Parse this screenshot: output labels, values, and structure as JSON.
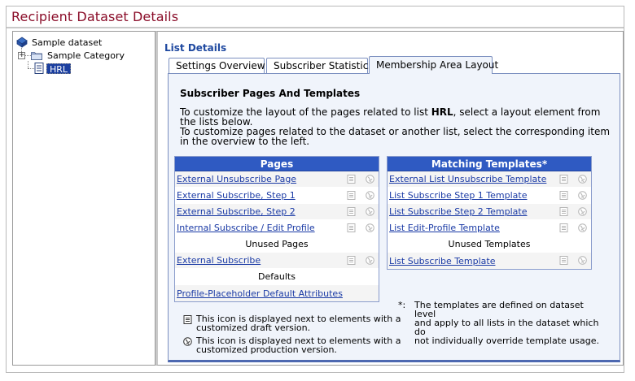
{
  "title": "Recipient Dataset Details",
  "tree": {
    "root": "Sample dataset",
    "category": "Sample Category",
    "selected": "HRL"
  },
  "list_details_title": "List Details",
  "tabs": [
    {
      "label": "Settings Overview"
    },
    {
      "label": "Subscriber Statistics"
    },
    {
      "label": "Membership Area Layout"
    }
  ],
  "section": {
    "title": "Subscriber Pages And Templates",
    "para1_pre": "To customize the layout of the pages related to list ",
    "para1_list": "HRL",
    "para1_post": ", select a layout element from the lists below.",
    "para2": "To customize pages related to the dataset or another list, select the corresponding item in the overview to the left."
  },
  "pages_table": {
    "header": "Pages",
    "rows": [
      {
        "label": "External Unsubscribe Page"
      },
      {
        "label": "External Subscribe, Step 1"
      },
      {
        "label": "External Subscribe, Step 2"
      },
      {
        "label": "Internal Subscribe / Edit Profile"
      }
    ],
    "unused_header": "Unused Pages",
    "unused_rows": [
      {
        "label": "External Subscribe"
      }
    ],
    "defaults_header": "Defaults",
    "defaults_rows": [
      {
        "label": "Profile-Placeholder Default Attributes"
      }
    ]
  },
  "templates_table": {
    "header": "Matching Templates*",
    "rows": [
      {
        "label": "External List Unsubscribe Template"
      },
      {
        "label": "List Subscribe Step 1 Template"
      },
      {
        "label": "List Subscribe Step 2 Template"
      },
      {
        "label": "List Edit-Profile Template"
      }
    ],
    "unused_header": "Unused Templates",
    "unused_rows": [
      {
        "label": "List Subscribe Template"
      }
    ]
  },
  "legend": {
    "draft_line1": "This icon is displayed next to elements with a",
    "draft_line2": "customized draft version.",
    "production_line1": "This icon is displayed next to elements with a",
    "production_line2": "customized production version."
  },
  "footnote": {
    "mark": "*:",
    "line1": "The templates are defined on dataset level",
    "line2": "and apply to all lists in the dataset which do",
    "line3": "not individually override template usage."
  },
  "colors": {
    "title_red": "#8b0e2a",
    "header_blue": "#2f5ac2",
    "link_blue": "#1a3aa5",
    "panel_bg": "#f0f4fb"
  },
  "icons": {
    "draft": "document-icon",
    "production": "globe-icon"
  }
}
